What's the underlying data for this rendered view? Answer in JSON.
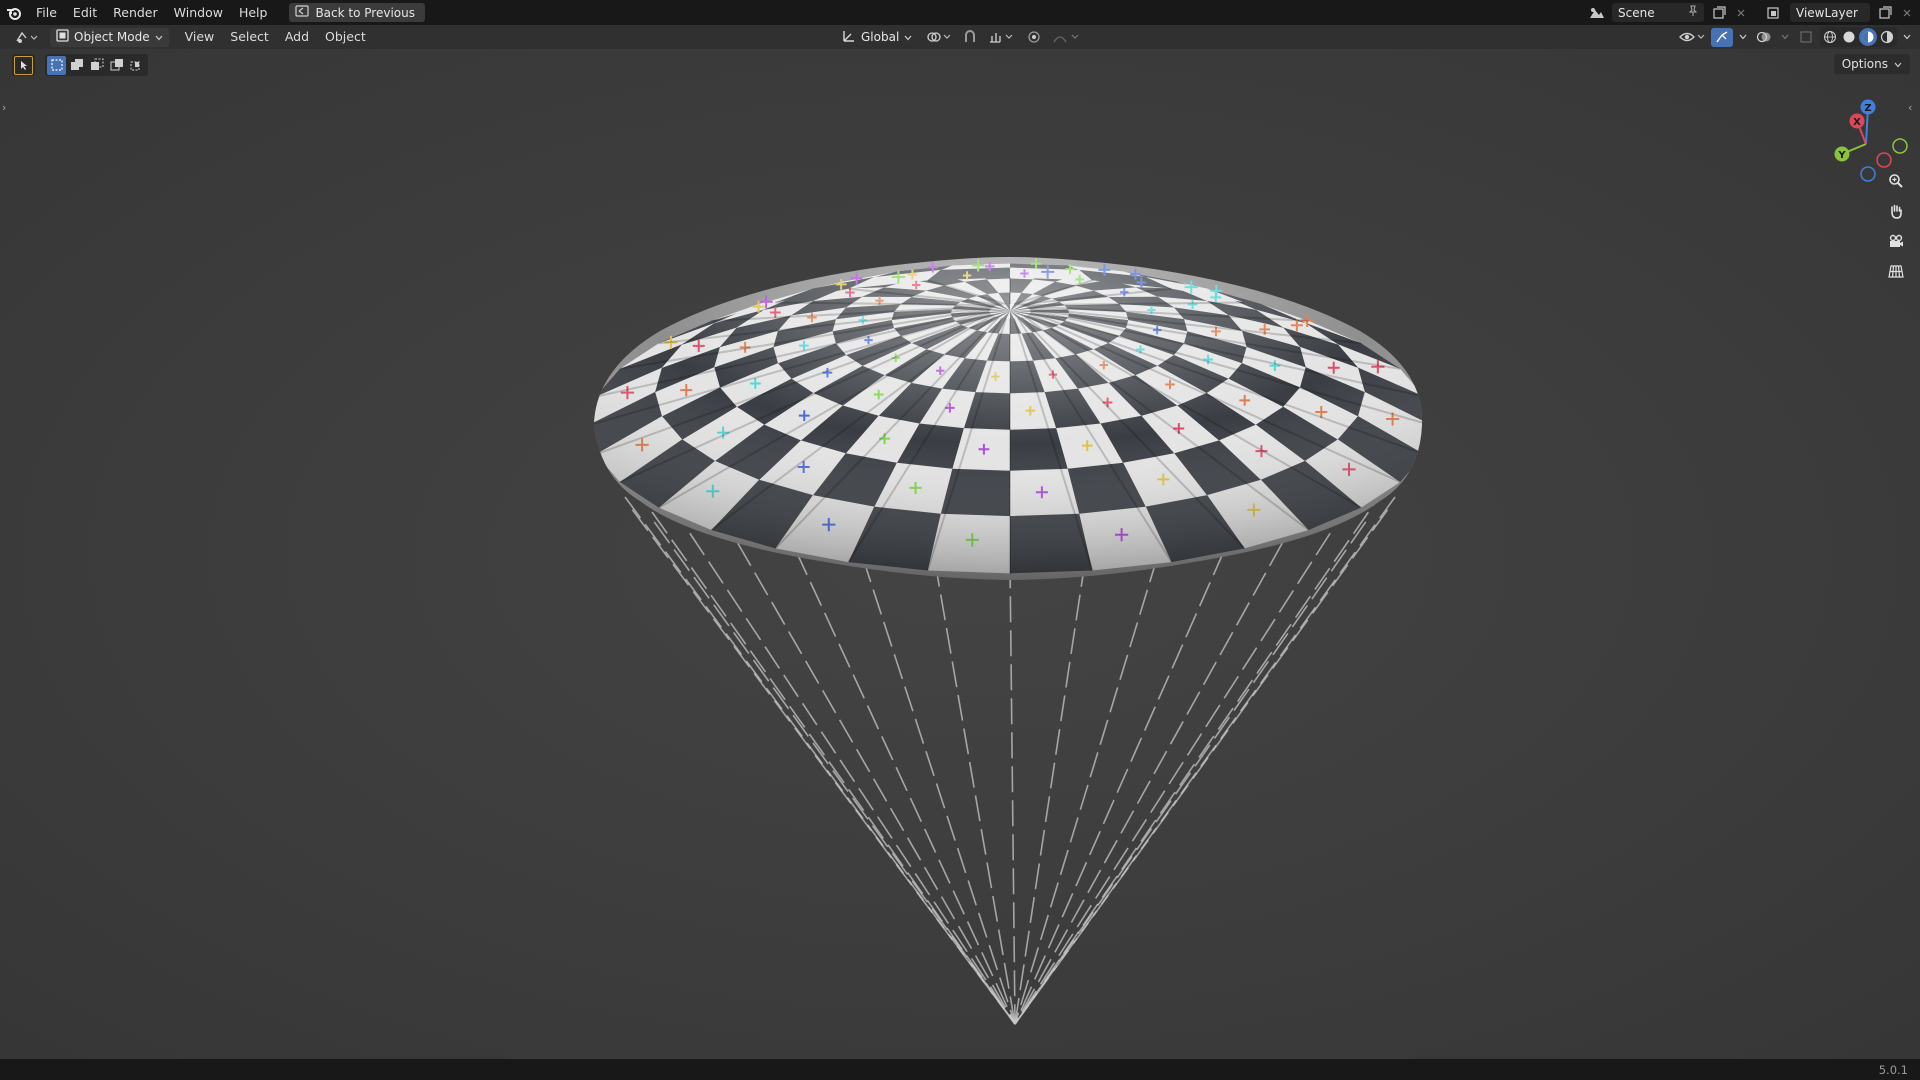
{
  "menu": {
    "file": "File",
    "edit": "Edit",
    "render": "Render",
    "window": "Window",
    "help": "Help",
    "back_to_previous": "Back to Previous"
  },
  "topbar_right": {
    "scene": "Scene",
    "view_layer": "ViewLayer"
  },
  "viewport_header": {
    "mode": "Object Mode",
    "view": "View",
    "select": "Select",
    "add": "Add",
    "object": "Object",
    "orientation": "Global"
  },
  "viewport": {
    "options": "Options",
    "gizmo_labels": {
      "x": "X",
      "y": "Y",
      "z": "Z"
    }
  },
  "status_bar": {
    "version": "5.0.1"
  },
  "colors": {
    "accent": "#4772b3",
    "axis_x": "#e0465a",
    "axis_y": "#8bc33a",
    "axis_z": "#3f7fe0"
  },
  "icons": [
    "blender-logo-icon",
    "back-icon",
    "editor-type-icon",
    "object-mode-icon",
    "orientation-icon",
    "pivot-icon",
    "snap-icon",
    "proportional-icon",
    "visibility-icon",
    "gizmo-icon",
    "overlay-icon",
    "xray-icon",
    "wireframe-shading-icon",
    "solid-shading-icon",
    "material-shading-icon",
    "rendered-shading-icon",
    "zoom-icon",
    "hand-pan-icon",
    "camera-icon",
    "grid-view-icon"
  ]
}
